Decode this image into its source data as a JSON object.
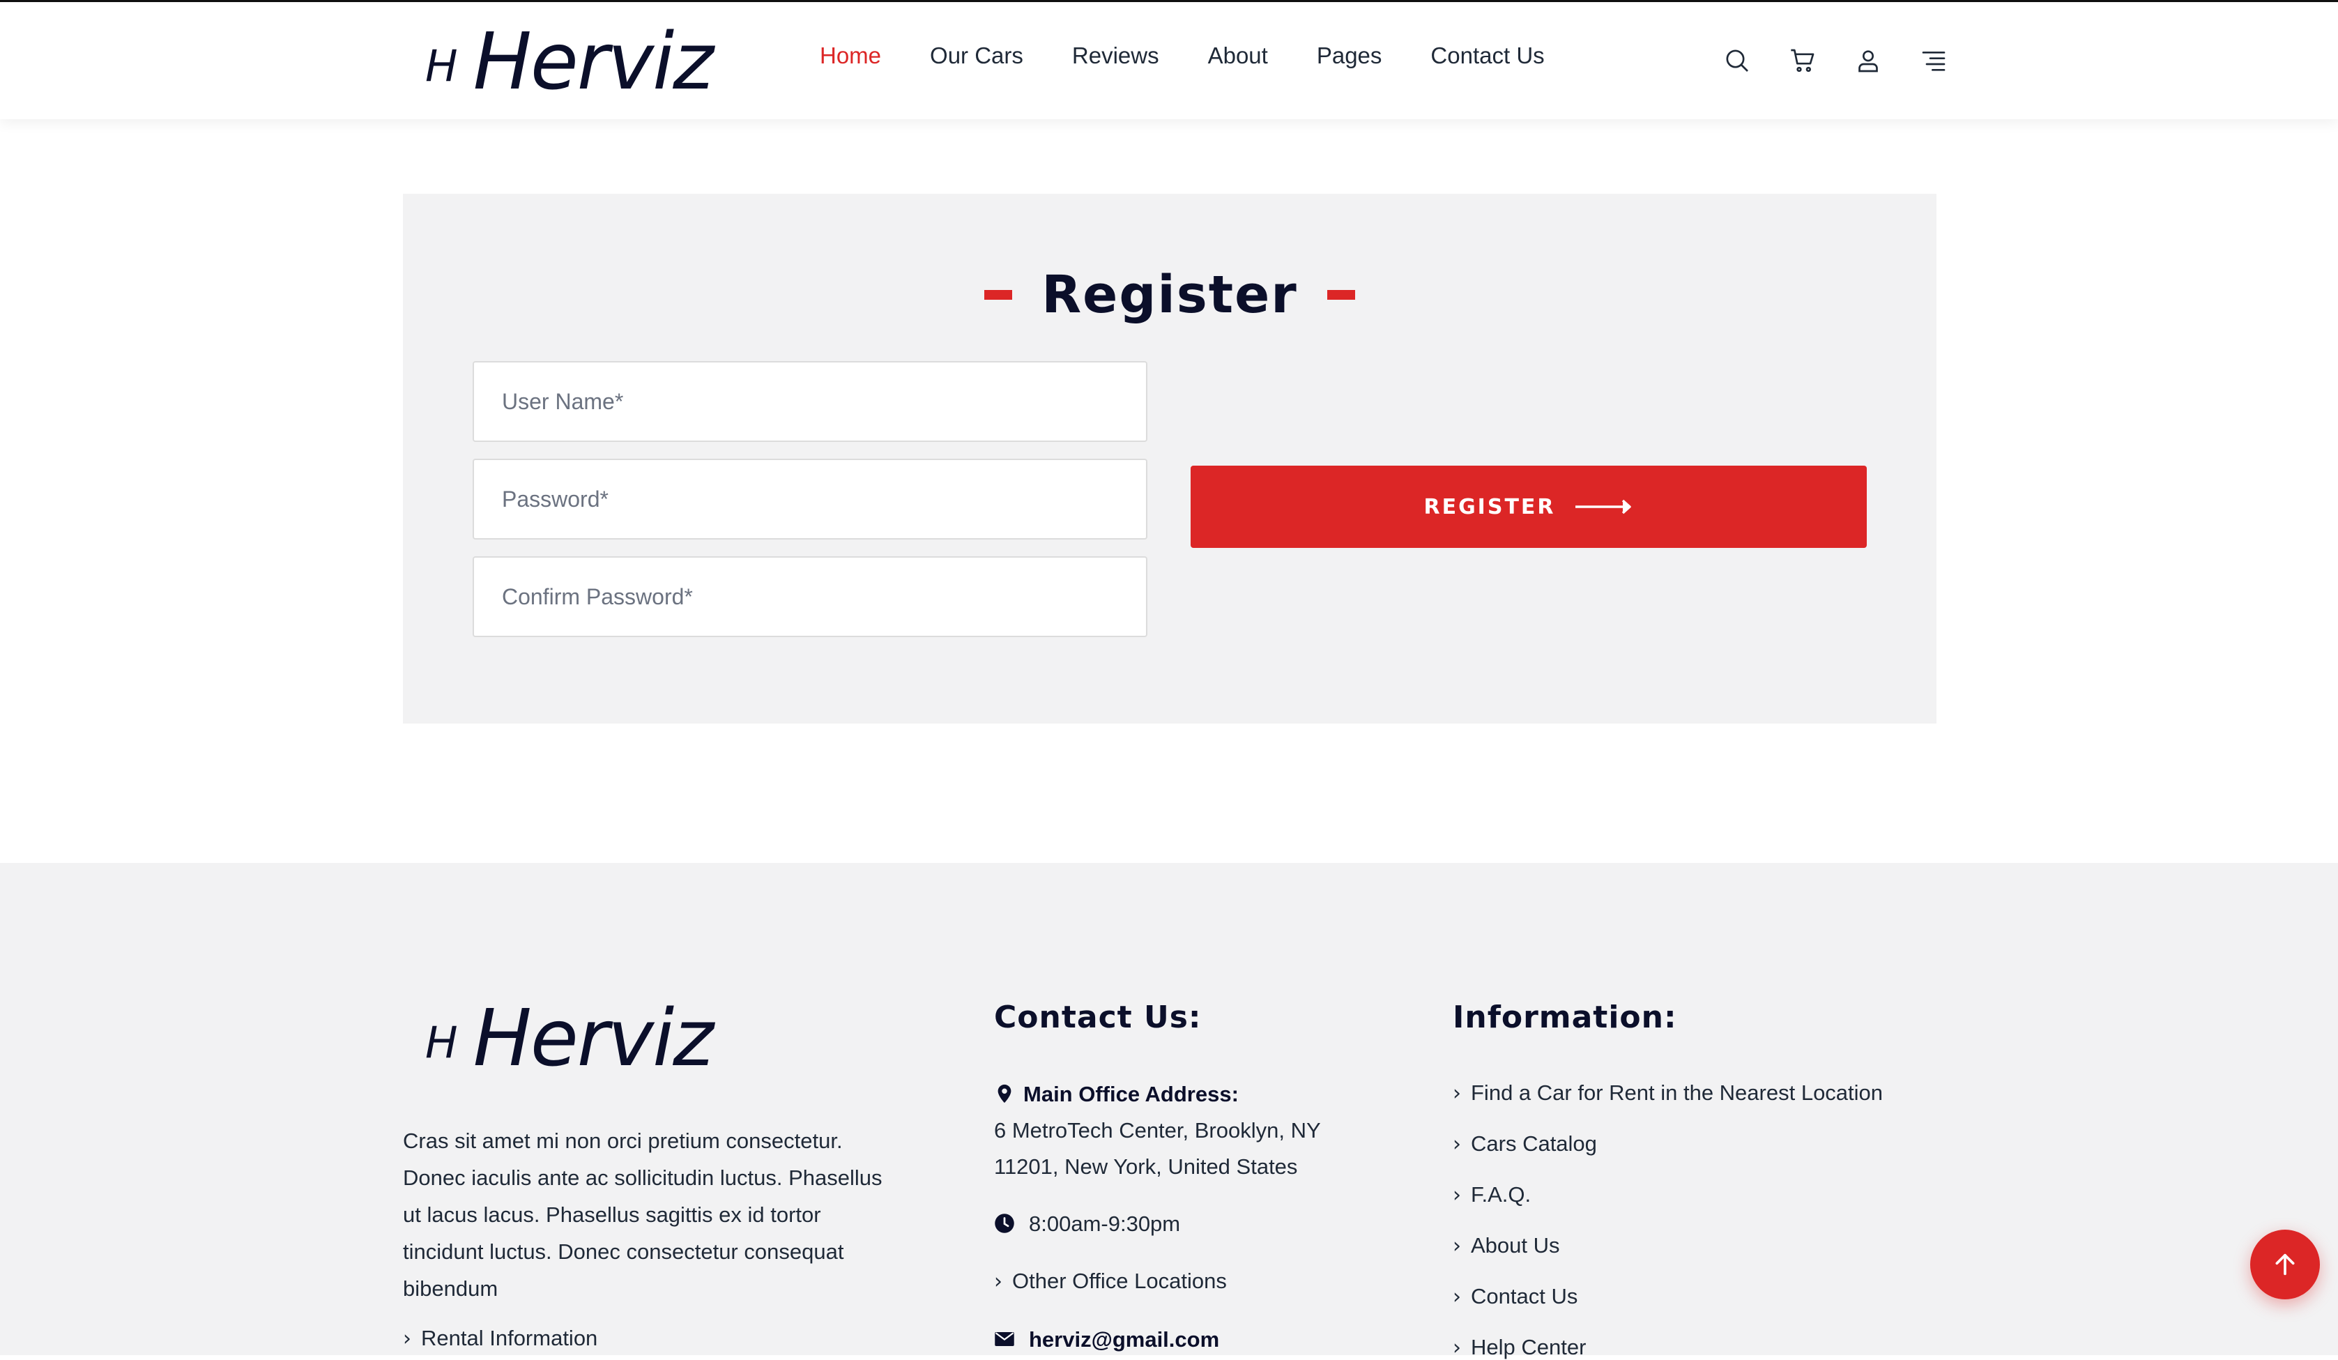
{
  "brand": {
    "mark": "H",
    "name": "Herviz"
  },
  "nav": [
    {
      "label": "Home",
      "active": true
    },
    {
      "label": "Our Cars"
    },
    {
      "label": "Reviews"
    },
    {
      "label": "About"
    },
    {
      "label": "Pages"
    },
    {
      "label": "Contact Us"
    }
  ],
  "header_icons": [
    "search-icon",
    "cart-icon",
    "user-icon",
    "menu-icon"
  ],
  "register": {
    "title": "Register",
    "username_placeholder": "User Name*",
    "password_placeholder": "Password*",
    "confirm_placeholder": "Confirm Password*",
    "button_label": "REGISTER"
  },
  "footer": {
    "description": "Cras sit amet mi non orci pretium consectetur. Donec iaculis ante ac sollicitudin luctus. Phasellus ut lacus lacus. Phasellus sagittis ex id tortor tincidunt luctus. Donec consectetur consequat bibendum",
    "rental_link": "Rental Information",
    "contact": {
      "heading": "Contact Us:",
      "address_label": "Main Office Address:",
      "address_line1": "6 MetroTech Center, Brooklyn, NY",
      "address_line2": "11201, New York, United States",
      "hours": "8:00am-9:30pm",
      "other_offices": "Other Office Locations",
      "email": "herviz@gmail.com"
    },
    "information": {
      "heading": "Information:",
      "links": [
        "Find a Car for Rent in the Nearest Location",
        "Cars Catalog",
        "F.A.Q.",
        "About Us",
        "Contact Us",
        "Help Center"
      ]
    }
  },
  "colors": {
    "accent": "#dc2626",
    "dark": "#0b0f2a",
    "panel": "#f2f2f3"
  }
}
